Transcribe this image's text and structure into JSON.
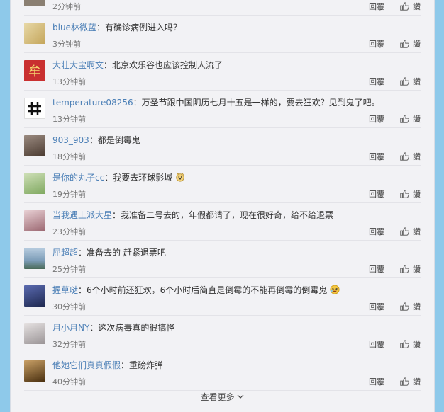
{
  "labels": {
    "reply": "回覆",
    "like": "讚",
    "more": "查看更多"
  },
  "comments": [
    {
      "user": "",
      "text": "",
      "time": "2分钟前",
      "avatar_color": "#8a7f72"
    },
    {
      "user": "blue林微蓝",
      "text": "有确诊病例进入吗？",
      "time": "3分钟前",
      "avatar_color": "#d7c07a"
    },
    {
      "user": "大壮大宝啊文",
      "text": "北京欢乐谷也应该控制人流了",
      "time": "13分钟前",
      "avatar_color": "#c93030"
    },
    {
      "user": "temperature08256",
      "text": "万圣节跟中国阴历七月十五是一样的，要去狂欢？见到鬼了吧。",
      "time": "13分钟前",
      "avatar_color": "#ffffff"
    },
    {
      "user": "903_903",
      "text": "都是倒霉鬼",
      "time": "18分钟前",
      "avatar_color": "#6b5a4f"
    },
    {
      "user": "是你的丸子cc",
      "text": "我要去环球影城",
      "time": "19分钟前",
      "avatar_color": "#a8c98a"
    },
    {
      "user": "当我遇上派大星",
      "text": "我准备二号去的，年假都请了，现在很好奇，给不给退票",
      "time": "23分钟前",
      "avatar_color": "#c9a0a8"
    },
    {
      "user": "屈超超",
      "text": "准备去的 赶紧退票吧",
      "time": "25分钟前",
      "avatar_color": "#7d9db8"
    },
    {
      "user": "握草哒",
      "text": "6个小时前还狂欢，6个小时后简直是倒霉的不能再倒霉的倒霉鬼",
      "time": "30分钟前",
      "avatar_color": "#3c4a7a"
    },
    {
      "user": "月小月NY",
      "text": "这次病毒真的很搞怪",
      "time": "32分钟前",
      "avatar_color": "#c7c3c4"
    },
    {
      "user": "他她它们真真假假",
      "text": "重磅炸弹",
      "time": "40分钟前",
      "avatar_color": "#7a5a2e"
    }
  ],
  "colors": {
    "background": "#8ec9ea",
    "panel": "#f2f2f5",
    "username": "#4b7fb6"
  },
  "icons": {
    "like": "thumb-up-icon",
    "more": "chevron-down-icon"
  }
}
